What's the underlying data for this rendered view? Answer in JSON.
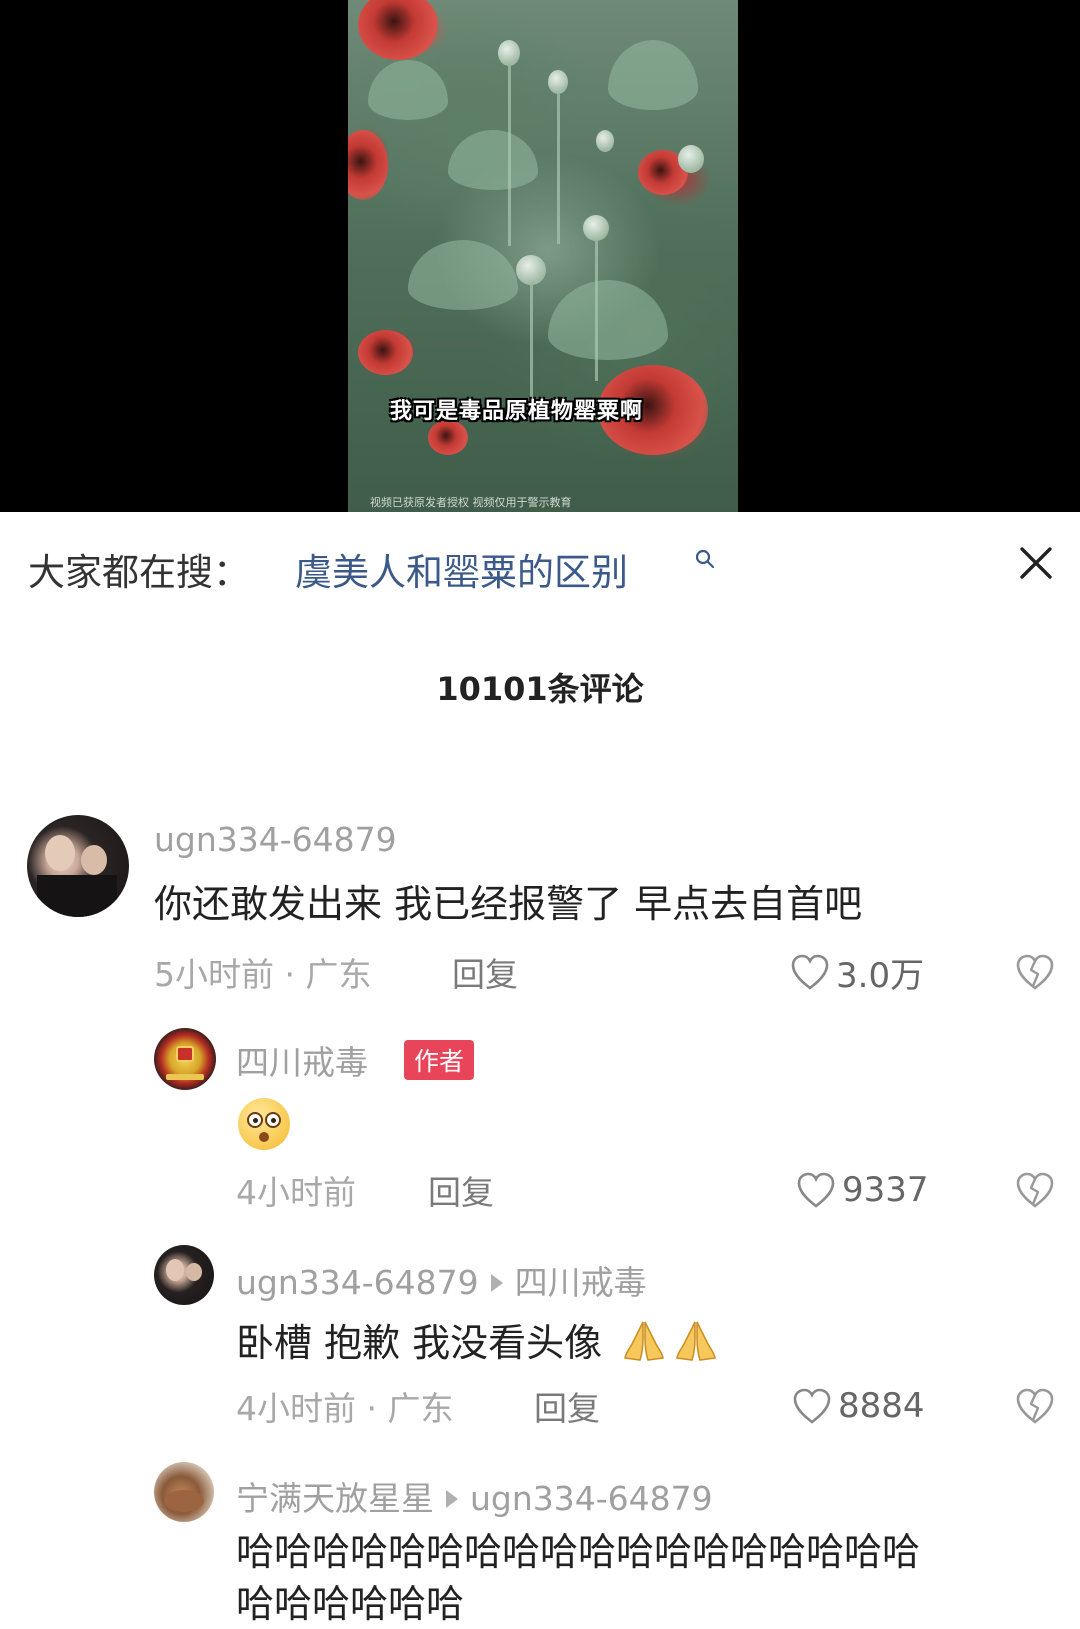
{
  "video": {
    "caption": "我可是毒品原植物罂粟啊",
    "disclaimer": "视频已获原发者授权 视频仅用于警示教育"
  },
  "search": {
    "prefix": "大家都在搜：",
    "term": "虞美人和罂粟的区别"
  },
  "comments_header": {
    "count_label": "10101条评论"
  },
  "comments": [
    {
      "username": "ugn334-64879",
      "text": "你还敢发出来  我已经报警了 早点去自首吧",
      "meta": "5小时前 · 广东",
      "reply_label": "回复",
      "likes": "3.0万"
    },
    {
      "username": "四川戒毒",
      "badge": "作者",
      "meta": "4小时前",
      "reply_label": "回复",
      "likes": "9337"
    },
    {
      "username": "ugn334-64879",
      "reply_to": "四川戒毒",
      "text": "卧槽 抱歉 我没看头像",
      "meta": "4小时前 · 广东",
      "reply_label": "回复",
      "likes": "8884"
    },
    {
      "username": "宁满天放星星",
      "reply_to": "ugn334-64879",
      "text_line1": "哈哈哈哈哈哈哈哈哈哈哈哈哈哈哈哈哈哈",
      "text_line2": "哈哈哈哈哈哈"
    }
  ],
  "colors": {
    "link_blue": "#3b5a8a",
    "author_badge": "#e8445a",
    "muted_text": "#a0a0a0"
  },
  "icons": [
    "search-icon",
    "close-icon",
    "heart-icon",
    "broken-heart-icon",
    "shocked-emoji",
    "praying-hands-emoji"
  ]
}
